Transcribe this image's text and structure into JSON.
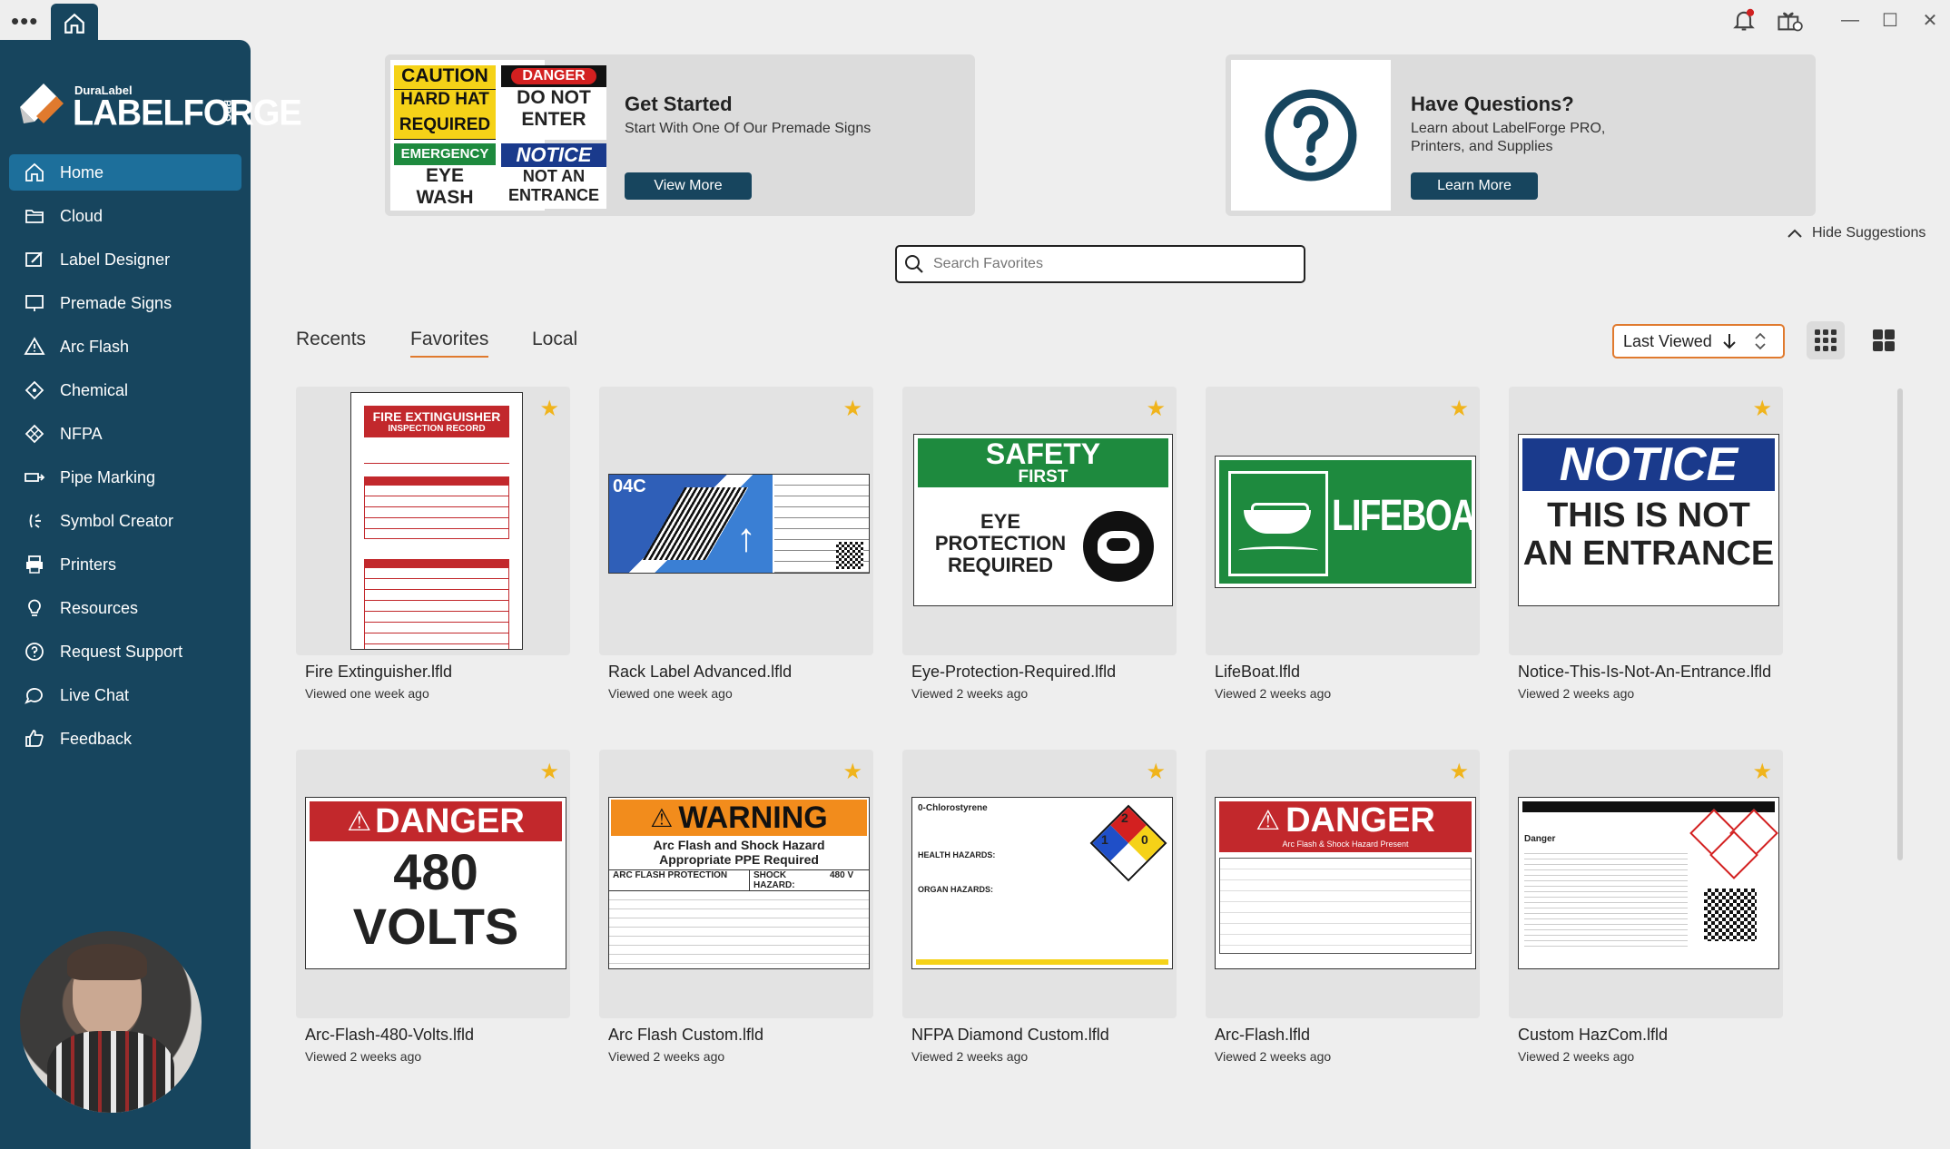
{
  "window": {
    "menu_glyph": "•••",
    "icons": [
      "home-icon",
      "bell-icon",
      "gift-icon"
    ],
    "controls": {
      "minimize": "—",
      "maximize": "☐",
      "close": "✕"
    }
  },
  "brand": {
    "small": "DuraLabel",
    "name": "LABELFORGE",
    "edition": "PRO"
  },
  "sidebar": {
    "items": [
      {
        "label": "Home",
        "icon": "home-icon"
      },
      {
        "label": "Cloud",
        "icon": "cloud-folder-icon"
      },
      {
        "label": "Label Designer",
        "icon": "pencil-icon"
      },
      {
        "label": "Premade Signs",
        "icon": "sign-icon"
      },
      {
        "label": "Arc Flash",
        "icon": "warning-triangle-icon"
      },
      {
        "label": "Chemical",
        "icon": "diamond-icon"
      },
      {
        "label": "NFPA",
        "icon": "nfpa-diamond-icon"
      },
      {
        "label": "Pipe Marking",
        "icon": "pipe-icon"
      },
      {
        "label": "Symbol Creator",
        "icon": "symbol-icon"
      },
      {
        "label": "Printers",
        "icon": "printer-icon"
      },
      {
        "label": "Resources",
        "icon": "lightbulb-icon"
      },
      {
        "label": "Request Support",
        "icon": "question-circle-icon"
      },
      {
        "label": "Live Chat",
        "icon": "chat-icon"
      },
      {
        "label": "Feedback",
        "icon": "thumbs-up-icon"
      }
    ]
  },
  "suggestions": {
    "get_started": {
      "title": "Get Started",
      "subtitle": "Start With One Of Our Premade Signs",
      "button": "View More",
      "signs": {
        "caution": "CAUTION",
        "hard_hat_1": "HARD HAT",
        "hard_hat_2": "REQUIRED",
        "danger": "DANGER",
        "do_not_1": "DO NOT",
        "do_not_2": "ENTER",
        "emergency": "EMERGENCY",
        "eye_1": "EYE",
        "eye_2": "WASH",
        "notice": "NOTICE",
        "not_an_1": "NOT AN",
        "not_an_2": "ENTRANCE"
      }
    },
    "questions": {
      "title": "Have Questions?",
      "subtitle_1": "Learn about LabelForge PRO,",
      "subtitle_2": "Printers, and Supplies",
      "button": "Learn More"
    },
    "hide_label": "Hide Suggestions"
  },
  "search": {
    "placeholder": "Search Favorites"
  },
  "tabs": [
    {
      "label": "Recents"
    },
    {
      "label": "Favorites",
      "active": true
    },
    {
      "label": "Local"
    }
  ],
  "sort": {
    "label": "Last Viewed"
  },
  "files": [
    {
      "name": "Fire Extinguisher.lfld",
      "viewed": "Viewed one week ago"
    },
    {
      "name": "Rack Label Advanced.lfld",
      "viewed": "Viewed one week ago"
    },
    {
      "name": "Eye-Protection-Required.lfld",
      "viewed": "Viewed 2 weeks ago"
    },
    {
      "name": "LifeBoat.lfld",
      "viewed": "Viewed 2 weeks ago"
    },
    {
      "name": "Notice-This-Is-Not-An-Entrance.lfld",
      "viewed": "Viewed 2 weeks ago"
    },
    {
      "name": "Arc-Flash-480-Volts.lfld",
      "viewed": "Viewed 2 weeks ago"
    },
    {
      "name": "Arc Flash Custom.lfld",
      "viewed": "Viewed 2 weeks ago"
    },
    {
      "name": "NFPA Diamond Custom.lfld",
      "viewed": "Viewed 2 weeks ago"
    },
    {
      "name": "Arc-Flash.lfld",
      "viewed": "Viewed 2 weeks ago"
    },
    {
      "name": "Custom HazCom.lfld",
      "viewed": "Viewed 2 weeks ago"
    }
  ],
  "thumbs": {
    "fire": {
      "title_1": "FIRE EXTINGUISHER",
      "title_2": "INSPECTION RECORD"
    },
    "rack": {
      "code": "04C"
    },
    "eye": {
      "header_1": "SAFETY",
      "header_2": "FIRST",
      "body_1": "EYE",
      "body_2": "PROTECTION",
      "body_3": "REQUIRED"
    },
    "lifeboat": {
      "text": "LIFEBOAT"
    },
    "notice": {
      "header": "NOTICE",
      "body_1": "THIS IS NOT",
      "body_2": "AN ENTRANCE"
    },
    "danger480": {
      "header": "DANGER",
      "body_1": "480",
      "body_2": "VOLTS"
    },
    "arcwarn": {
      "header": "WARNING",
      "sub_1": "Arc Flash and Shock Hazard",
      "sub_2": "Appropriate PPE Required",
      "col_1": "ARC FLASH PROTECTION",
      "col_2": "SHOCK HAZARD:",
      "volts": "480 V"
    },
    "nfpa": {
      "chem": "0-Chlorostyrene",
      "flam": "2",
      "react": "0",
      "health": "1",
      "health_hdr": "HEALTH HAZARDS:",
      "organ_hdr": "ORGAN HAZARDS:"
    },
    "arcdanger": {
      "header": "DANGER",
      "sub": "Arc Flash & Shock Hazard Present"
    },
    "hazcom": {
      "word": "Danger"
    }
  },
  "colors": {
    "sidebar": "#17455e",
    "active": "#1d6f9b",
    "accent": "#e07a2e",
    "star": "#f0b41c"
  }
}
